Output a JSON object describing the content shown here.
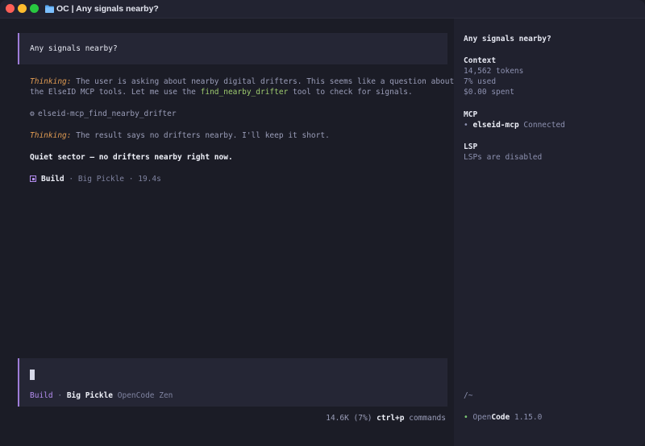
{
  "window": {
    "title": "OC | Any signals nearby?"
  },
  "conversation": {
    "user_prompt": "Any signals nearby?",
    "thinking_label": "Thinking:",
    "thinking_1": {
      "line1": "The user is asking about nearby digital drifters. This seems like a question about",
      "line2_pre": "the ElseID MCP tools. Let me use the ",
      "tool_name": "find_nearby_drifter",
      "line2_post": " tool to check for signals."
    },
    "tool_call": "elseid-mcp_find_nearby_drifter",
    "thinking_2": "The result says no drifters nearby. I'll keep it short.",
    "answer": "Quiet sector — no drifters nearby right now.",
    "footer": {
      "mode": "Build",
      "sep": "·",
      "model": "Big Pickle",
      "duration": "19.4s"
    }
  },
  "input": {
    "mode": "Build",
    "sep": "·",
    "model": "Big Pickle",
    "provider": "OpenCode Zen"
  },
  "status_bar": {
    "tokens": "14.6K (7%)",
    "shortcut_key": "ctrl+p",
    "shortcut_label": "commands"
  },
  "sidebar": {
    "session_title": "Any signals nearby?",
    "context": {
      "heading": "Context",
      "tokens": "14,562 tokens",
      "used": "7% used",
      "spent": "$0.00 spent"
    },
    "mcp": {
      "heading": "MCP",
      "bullet": "•",
      "server": "elseid-mcp",
      "status": "Connected"
    },
    "lsp": {
      "heading": "LSP",
      "status": "LSPs are disabled"
    },
    "cwd": "/~",
    "app": {
      "bullet": "•",
      "name_open": "Open",
      "name_code": "Code",
      "version": "1.15.0"
    }
  },
  "colors": {
    "accent": "#9d7cd8",
    "thinking": "#e09b52",
    "tool": "#9ecb6f",
    "connected": "#7dcb75"
  }
}
